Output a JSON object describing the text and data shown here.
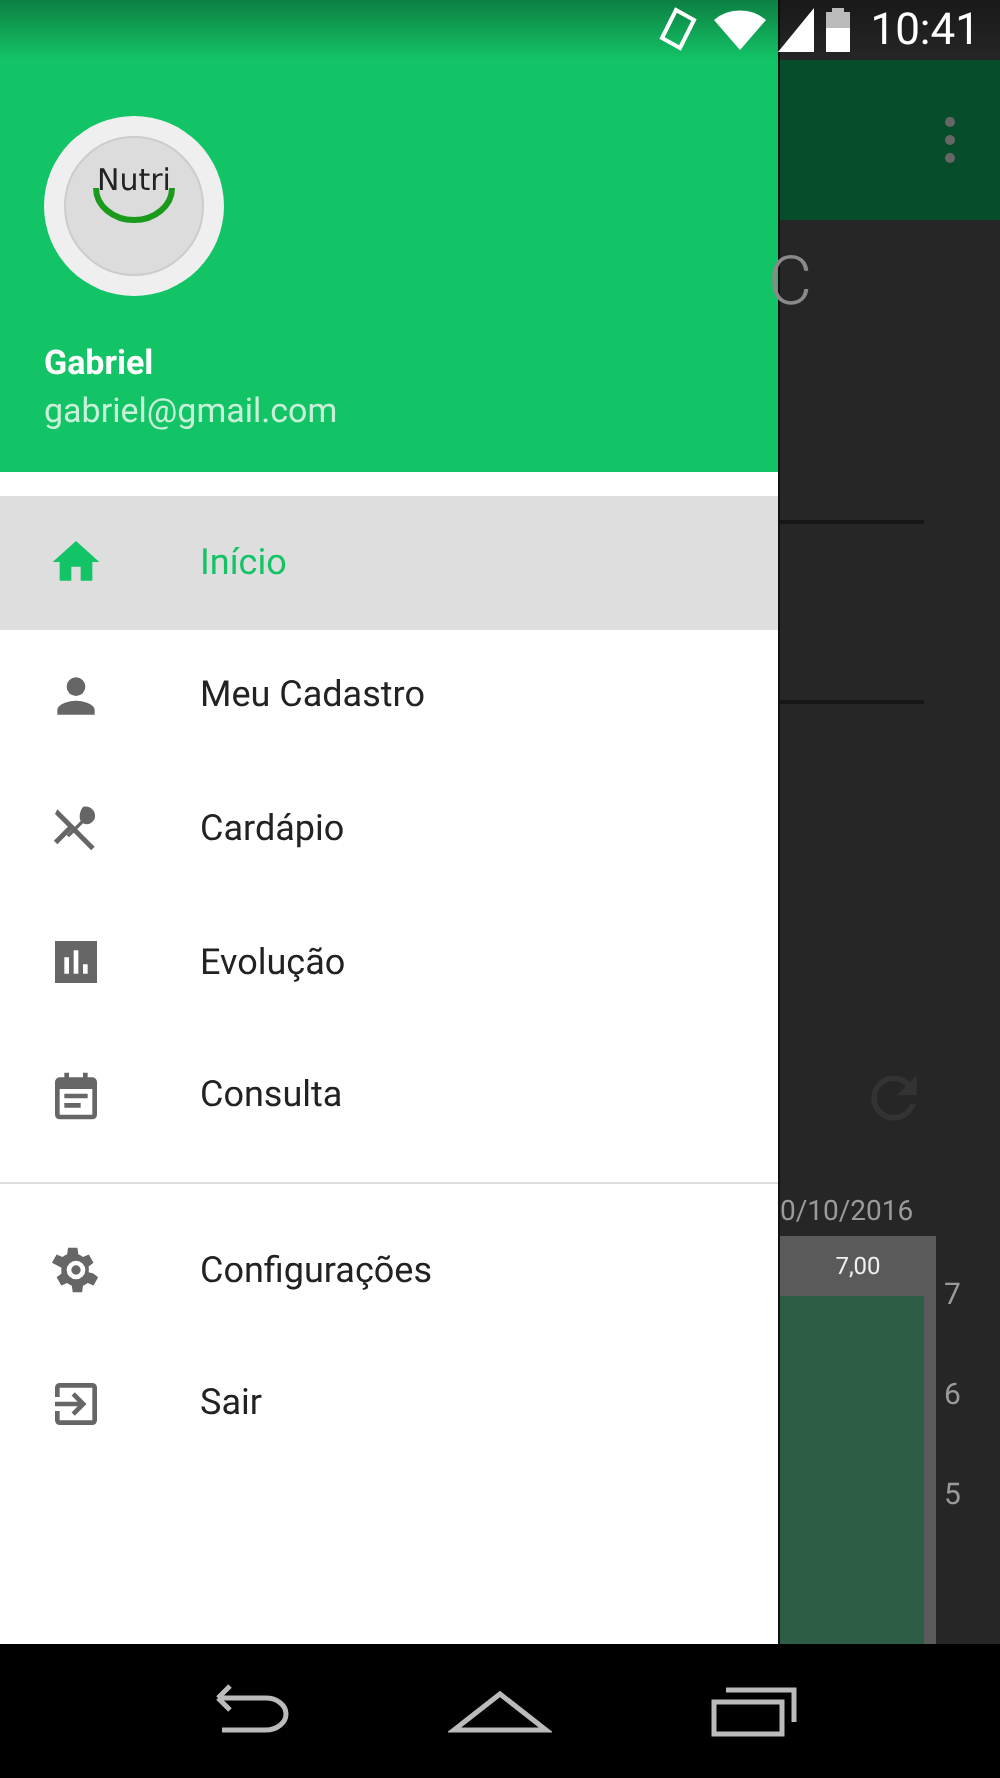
{
  "status_bar": {
    "time": "10:41"
  },
  "drawer": {
    "logo_text": "Nutri",
    "user_name": "Gabriel",
    "user_email": "gabriel@gmail.com",
    "sections": [
      {
        "items": [
          {
            "label": "Início",
            "selected": true
          },
          {
            "label": "Meu Cadastro",
            "selected": false
          },
          {
            "label": "Cardápio",
            "selected": false
          },
          {
            "label": "Evolução",
            "selected": false
          },
          {
            "label": "Consulta",
            "selected": false
          }
        ]
      },
      {
        "items": [
          {
            "label": "Configurações",
            "selected": false
          },
          {
            "label": "Sair",
            "selected": false
          }
        ]
      }
    ]
  },
  "background_screen": {
    "title_fragment": "C",
    "date_label": "0/10/2016",
    "bar_value_label": "7,00",
    "axis_ticks": [
      "7",
      "6",
      "5"
    ]
  }
}
